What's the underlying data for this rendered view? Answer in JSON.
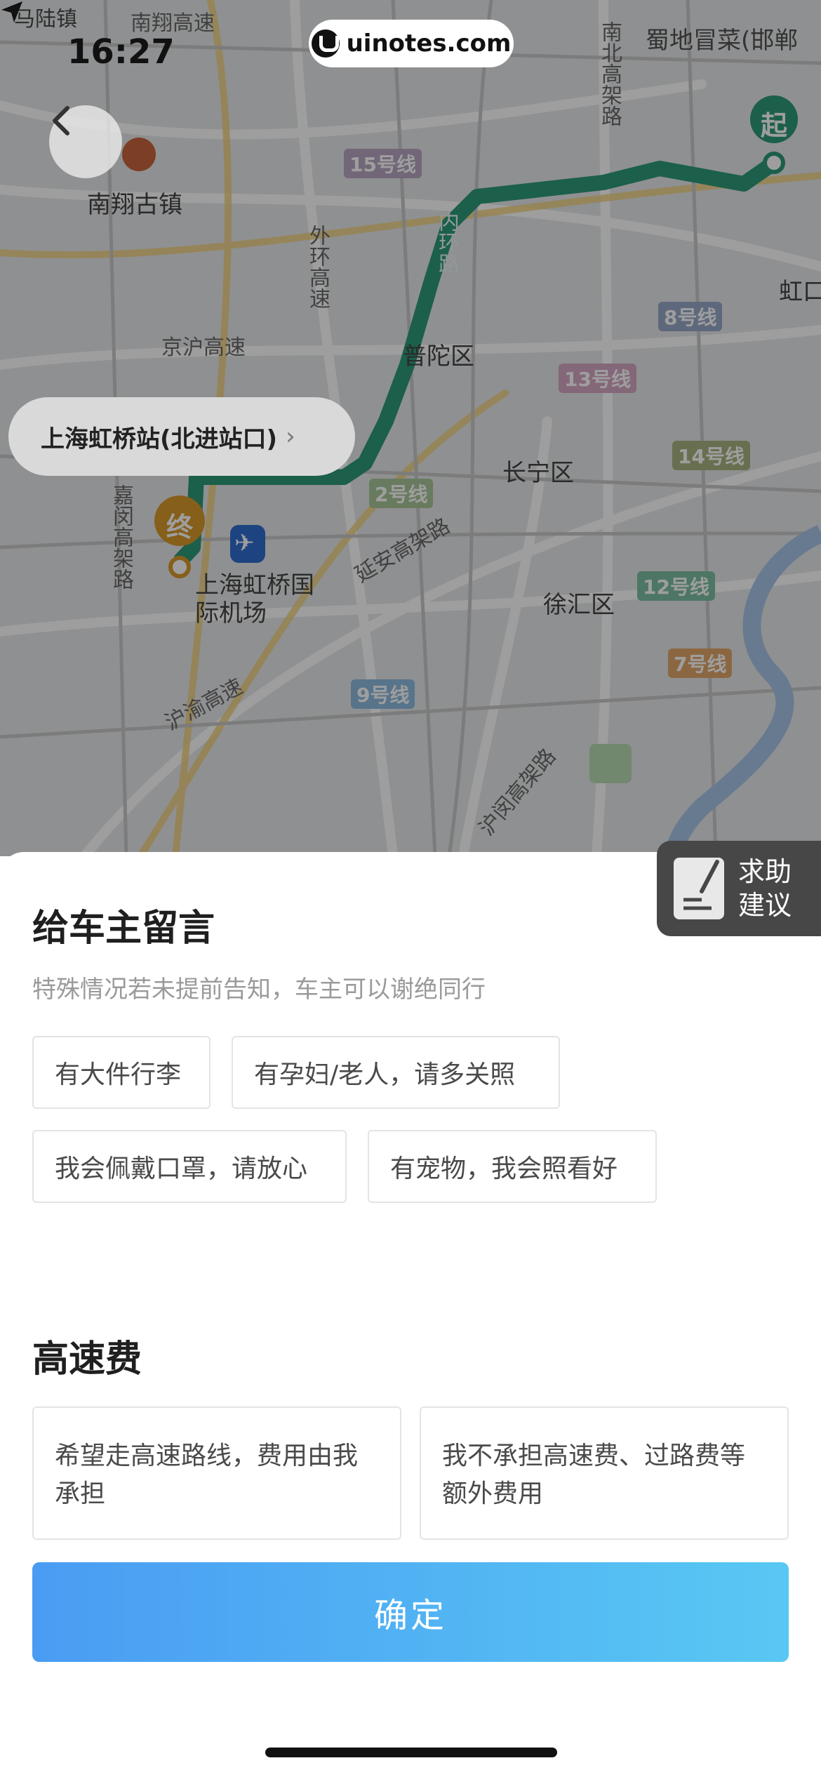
{
  "status_bar": {
    "time": "16:27",
    "right_text": "蜀地冒菜(邯郸"
  },
  "watermark": {
    "text": "uinotes.com"
  },
  "map": {
    "places": {
      "malu": "马陆镇",
      "nanxiang_road": "南翔高速",
      "nanxiang_town": "南翔古镇",
      "outer_ring": "外环高速",
      "jinghu": "京沪高速",
      "putuo": "普陀区",
      "changning": "长宁区",
      "xuhui": "徐汇区",
      "hongkou": "虹口",
      "jiamin": "嘉闵高架路",
      "airport": "上海虹桥国际机场",
      "yanan": "延安高架路",
      "huyu": "沪渝高速",
      "humin": "沪闵高架路",
      "nanbei": "南北高架路",
      "inner_ring": "内环路"
    },
    "metro": [
      "15号线",
      "8号线",
      "13号线",
      "14号线",
      "2号线",
      "12号线",
      "7号线",
      "9号线"
    ],
    "start_marker": "起",
    "end_marker": "终",
    "station_chip": "上海虹桥站(北进站口)",
    "colors": {
      "route": "#2e9a78",
      "start": "#2e9a78",
      "end": "#d99a2b",
      "airport": "#2f6fd1"
    }
  },
  "help": {
    "label": "求助\n建议"
  },
  "sheet": {
    "title": "给车主留言",
    "subtitle": "特殊情况若未提前告知，车主可以谢绝同行",
    "chips": [
      "有大件行李",
      "有孕妇/老人，请多关照",
      "我会佩戴口罩，请放心",
      "有宠物，我会照看好"
    ],
    "toll_title": "高速费",
    "toll_options": [
      "希望走高速路线，费用由我承担",
      "我不承担高速费、过路费等额外费用"
    ],
    "confirm": "确定"
  }
}
